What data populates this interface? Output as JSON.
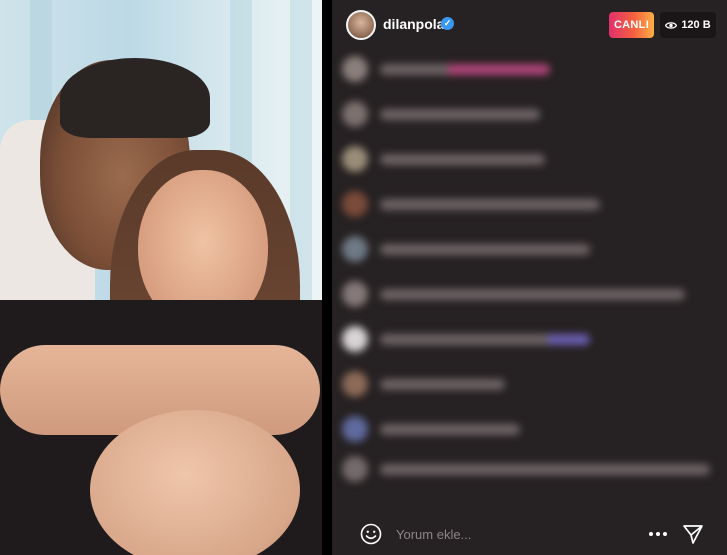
{
  "stream": {
    "username": "dilanpolat",
    "live_label": "CANLI",
    "viewer_count": "120 B"
  },
  "footer": {
    "comment_placeholder": "Yorum ekle..."
  },
  "icons": {
    "verified": "verified-badge-icon",
    "viewers": "eye-icon",
    "emoji": "smiley-icon",
    "more": "more-horizontal-icon",
    "send": "send-icon"
  },
  "colors": {
    "accent_live_start": "#e1306c",
    "accent_live_end": "#fcaf45",
    "verified": "#3897f0",
    "chat_background": "#262122"
  }
}
